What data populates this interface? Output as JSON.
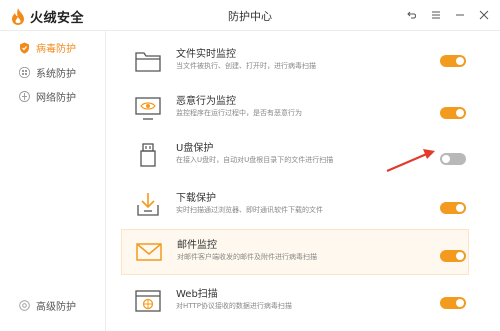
{
  "app": {
    "name": "火绒安全",
    "window_title": "防护中心"
  },
  "sidebar": {
    "items": [
      {
        "label": "病毒防护",
        "icon": "shield-icon",
        "active": true
      },
      {
        "label": "系统防护",
        "icon": "windows-icon",
        "active": false
      },
      {
        "label": "网络防护",
        "icon": "globe-icon",
        "active": false
      }
    ],
    "footer": {
      "label": "高级防护",
      "icon": "gear-icon"
    }
  },
  "features": [
    {
      "title": "文件实时监控",
      "desc": "当文件被执行、创建、打开时，进行病毒扫描",
      "icon": "folder-icon",
      "enabled": true
    },
    {
      "title": "恶意行为监控",
      "desc": "监控程序在运行过程中，是否有恶意行为",
      "icon": "monitor-eye-icon",
      "enabled": true
    },
    {
      "title": "U盘保护",
      "desc": "在接入U盘时，自动对U盘根目录下的文件进行扫描",
      "icon": "usb-icon",
      "enabled": false
    },
    {
      "title": "下载保护",
      "desc": "实时扫描通过浏览器、即时通讯软件下载的文件",
      "icon": "download-icon",
      "enabled": true
    },
    {
      "title": "邮件监控",
      "desc": "对邮件客户端收发的邮件及附件进行病毒扫描",
      "icon": "mail-icon",
      "enabled": true
    },
    {
      "title": "Web扫描",
      "desc": "对HTTP协议接收的数据进行病毒扫描",
      "icon": "web-icon",
      "enabled": true
    }
  ],
  "colors": {
    "accent": "#f29b1f",
    "toggle_off": "#b8b8b8",
    "arrow": "#e23b2e"
  }
}
